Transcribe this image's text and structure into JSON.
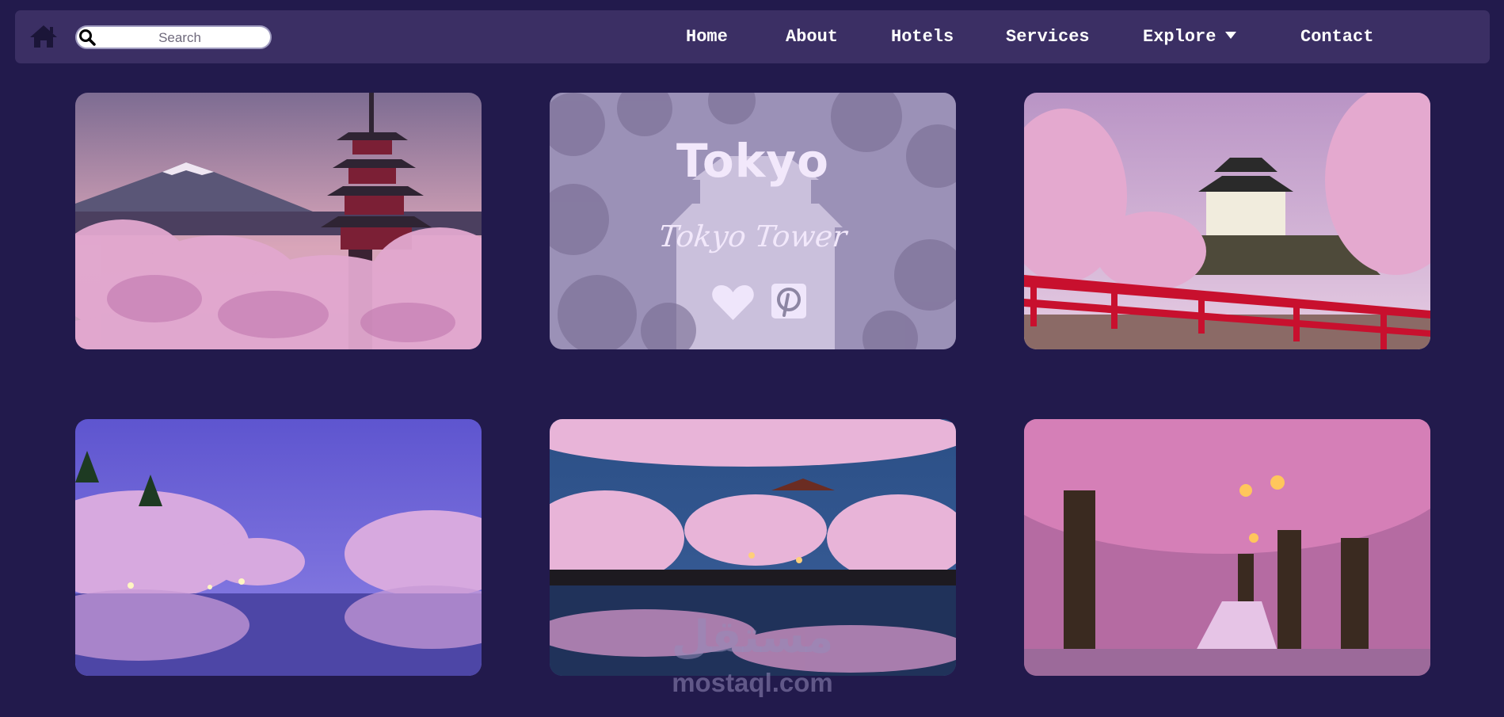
{
  "nav": {
    "home_icon": "home-icon",
    "search": {
      "placeholder": "Search",
      "icon": "search-icon"
    },
    "items": [
      {
        "label": "Home"
      },
      {
        "label": "About"
      },
      {
        "label": "Hotels"
      },
      {
        "label": "Services"
      },
      {
        "label": "Explore",
        "dropdown": true
      },
      {
        "label": "Contact"
      }
    ]
  },
  "gallery": {
    "cards": [
      {
        "scene": "mount-fuji-pagoda-cherry-blossoms"
      },
      {
        "scene": "castle-cherry-blossoms",
        "hovered": true,
        "title": "Tokyo",
        "subtitle": "Tokyo Tower",
        "icons": [
          "heart-icon",
          "pinterest-icon"
        ]
      },
      {
        "scene": "castle-red-bridge-cherry-blossoms"
      },
      {
        "scene": "river-night-cherry-blossoms"
      },
      {
        "scene": "pond-temple-cherry-blossoms-night"
      },
      {
        "scene": "cherry-blossom-lantern-path"
      }
    ]
  },
  "watermark": {
    "arabic": "مستقل",
    "latin": "mostaql.com"
  },
  "colors": {
    "background": "#221a4c",
    "navbar": "#3b2f64",
    "overlay_text": "#f2e8fb"
  }
}
